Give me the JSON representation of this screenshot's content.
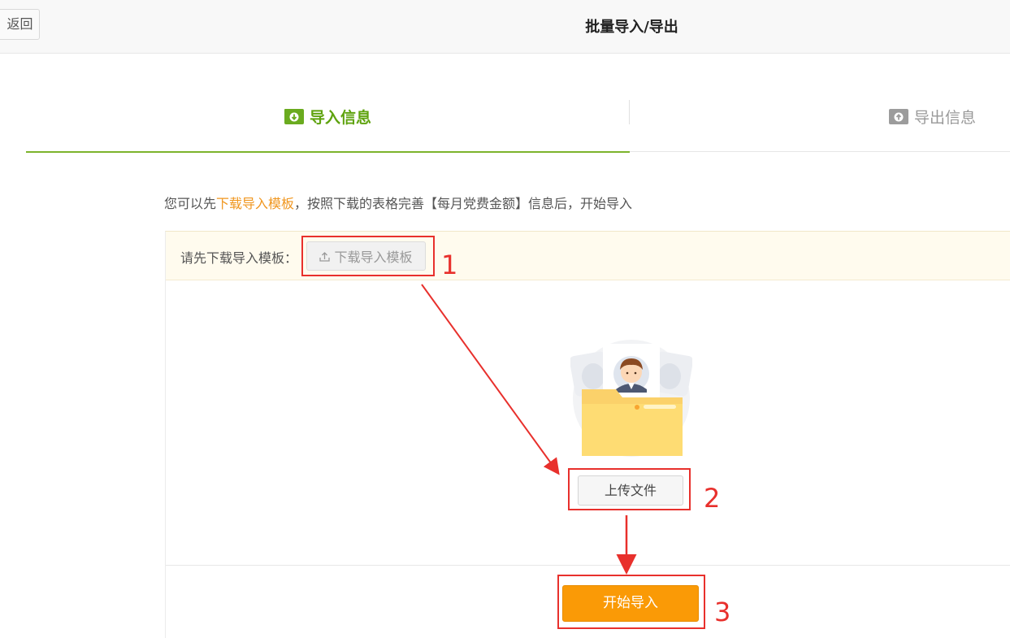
{
  "header": {
    "back_label": "返回",
    "title": "批量导入/导出"
  },
  "tabs": [
    {
      "label": "导入信息",
      "icon": "folder-download-icon",
      "active": true
    },
    {
      "label": "导出信息",
      "icon": "folder-upload-icon",
      "active": false
    }
  ],
  "intro": {
    "prefix": "您可以先",
    "link": "下载导入模板",
    "suffix": "，按照下载的表格完善【每月党费金额】信息后，开始导入"
  },
  "notice": {
    "label": "请先下载导入模板：",
    "download_button": "下载导入模板"
  },
  "upload": {
    "button": "上传文件"
  },
  "start": {
    "button": "开始导入"
  },
  "annotations": [
    "1",
    "2",
    "3"
  ],
  "colors": {
    "accent_green": "#6aab1f",
    "orange": "#fa9a06",
    "annotation_red": "#e8302c",
    "link_orange": "#f0961e"
  }
}
